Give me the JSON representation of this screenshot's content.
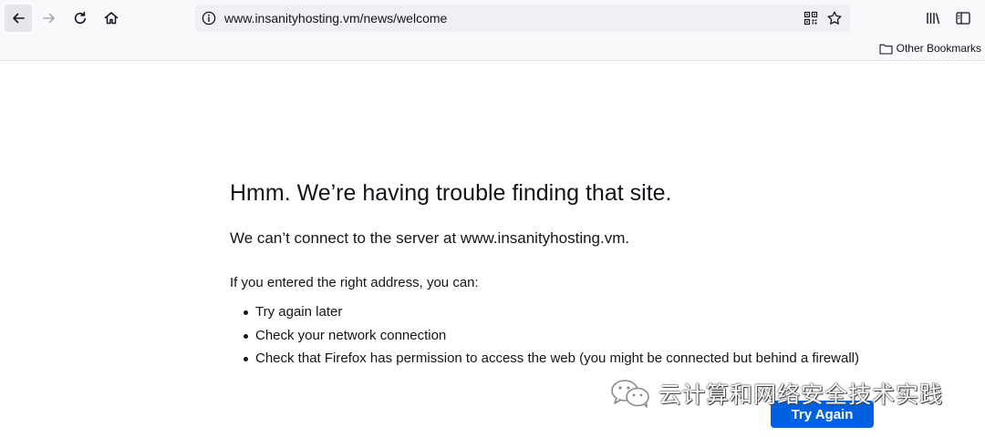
{
  "browser": {
    "url": "www.insanityhosting.vm/news/welcome",
    "bookmarks": {
      "other_bookmarks_label": "Other Bookmarks"
    },
    "icons": {
      "back": "back-arrow-icon",
      "forward": "forward-arrow-icon",
      "reload": "reload-icon",
      "home": "home-icon",
      "site_info": "info-icon",
      "qr": "qr-code-icon",
      "bookmark_star": "star-icon",
      "library": "library-icon",
      "sidebar": "sidebar-icon",
      "folder": "folder-icon"
    }
  },
  "error_page": {
    "title": "Hmm. We’re having trouble finding that site.",
    "short_description": "We can’t connect to the server at www.insanityhosting.vm.",
    "intro": "If you entered the right address, you can:",
    "suggestions": [
      "Try again later",
      "Check your network connection",
      "Check that Firefox has permission to access the web (you might be connected but behind a firewall)"
    ],
    "try_again_label": "Try Again"
  },
  "watermark": {
    "text": "云计算和网络安全技术实践"
  },
  "colors": {
    "accent": "#0061e0",
    "chrome_background": "#f9f9fb",
    "urlbar_background": "#f0f0f4",
    "text": "#15141a"
  }
}
